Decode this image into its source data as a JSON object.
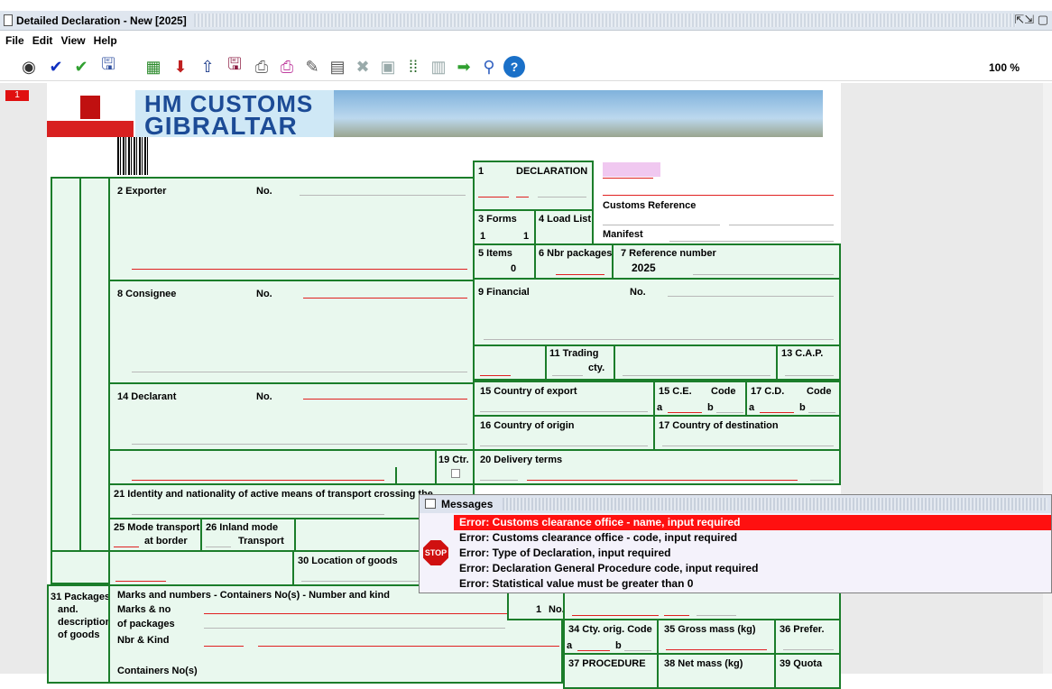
{
  "window": {
    "title": "Detailed Declaration - New [2025]",
    "controls": "⇱⇲ ▢"
  },
  "menu": [
    "File",
    "Edit",
    "View",
    "Help"
  ],
  "toolbar": {
    "icons": [
      "eye-icon",
      "check-blue-icon",
      "check-green-icon",
      "save-icon",
      "excel-icon",
      "xml-export-icon",
      "upload-icon",
      "xml-save-icon",
      "print-icon",
      "print-color-icon",
      "edit-icon",
      "document-icon",
      "delete-icon",
      "copy-icon",
      "grid-icon",
      "form-icon",
      "forward-icon",
      "search-icon",
      "help-icon"
    ],
    "zoom": "100 %"
  },
  "page": {
    "badge": "1"
  },
  "banner": {
    "line1": "HM CUSTOMS",
    "line2": "GIBRALTAR"
  },
  "form": {
    "box1": "1",
    "declaration": "DECLARATION",
    "exporter": "2 Exporter",
    "no": "No.",
    "customs_reference": "Customs Reference",
    "forms_label": "3 Forms",
    "forms_a": "1",
    "forms_b": "1",
    "load_list": "4 Load List",
    "manifest": "Manifest",
    "items_label": "5 Items",
    "items_value": "0",
    "nbr_packages": "6 Nbr packages",
    "reference_label": "7 Reference number",
    "reference_value": "2025",
    "consignee": "8 Consignee",
    "financial": "9 Financial",
    "trading": "11 Trading",
    "cty": "cty.",
    "cap": "13 C.A.P.",
    "declarant": "14 Declarant",
    "country_export": "15 Country of export",
    "ce": "15 C.E.",
    "code": "Code",
    "cd": "17 C.D.",
    "a": "a",
    "b": "b",
    "country_origin": "16 Country of origin",
    "country_destination": "17 Country of destination",
    "ctr": "19 Ctr.",
    "delivery": "20 Delivery terms",
    "identity": "21 Identity and nationality of active means of transport crossing the",
    "mode_transport": "25 Mode transport",
    "at_border": "at border",
    "inland_mode": "26 Inland mode",
    "transport": "Transport",
    "location_goods": "30 Location of goods",
    "packages_1": "31 Packages",
    "packages_2": "and.",
    "packages_3": "description",
    "packages_4": "of goods",
    "marks_header": "Marks and numbers - Containers No(s) - Number and kind",
    "marks_no": "Marks & no",
    "of_packages": "of packages",
    "nbr_kind": "Nbr & Kind",
    "containers": "Containers No(s)",
    "item_no_value": "1",
    "item_no_label": "No.",
    "cty_orig": "34 Cty. orig. Code",
    "gross_mass": "35 Gross mass (kg)",
    "prefer": "36 Prefer.",
    "procedure": "37 PROCEDURE",
    "net_mass": "38 Net mass (kg)",
    "quota": "39 Quota"
  },
  "messages": {
    "title": "Messages",
    "stop": "STOP",
    "items": [
      "Error: Customs clearance office - name, input required",
      "Error: Customs clearance office - code, input required",
      "Error: Type of Declaration, input required",
      "Error: Declaration General Procedure code, input required",
      "Error: Statistical value must be greater than 0"
    ]
  }
}
